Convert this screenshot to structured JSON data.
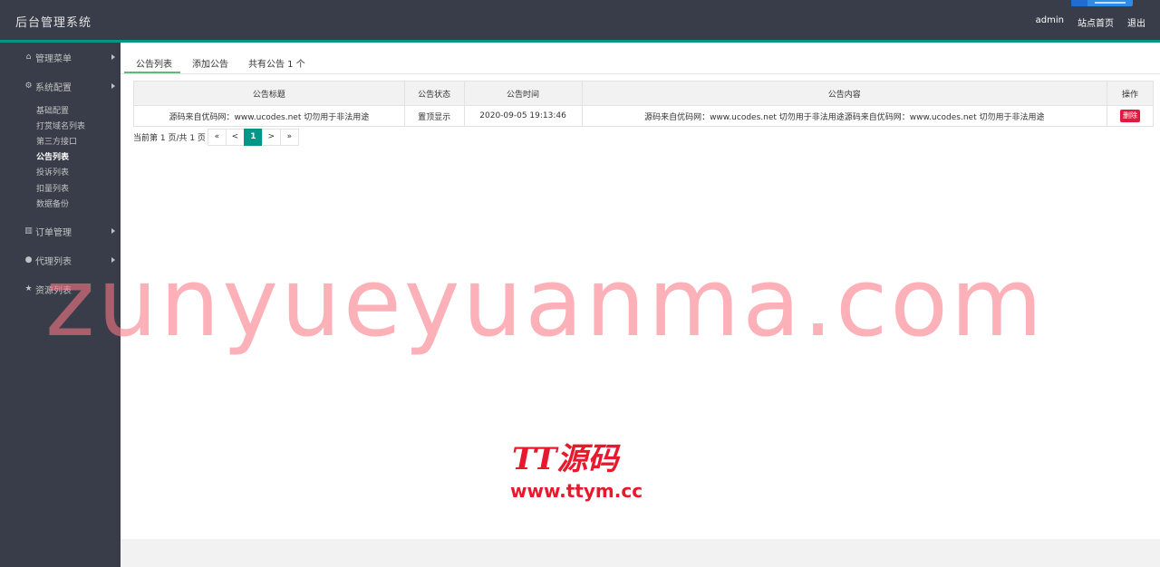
{
  "header": {
    "title": "后台管理系统",
    "links": [
      "admin",
      "站点首页",
      "退出"
    ]
  },
  "sidebar": {
    "items": [
      {
        "label": "管理菜单",
        "icon": "home-icon"
      },
      {
        "label": "系统配置",
        "icon": "gears-icon"
      },
      {
        "label": "订单管理",
        "icon": "bar-chart-icon"
      },
      {
        "label": "代理列表",
        "icon": "user-icon"
      },
      {
        "label": "资源列表",
        "icon": "star-icon"
      }
    ],
    "sub_items": [
      "基础配置",
      "打赏域名列表",
      "第三方接口",
      "公告列表",
      "投诉列表",
      "扣量列表",
      "数据备份"
    ]
  },
  "tabs": {
    "list": "公告列表",
    "add": "添加公告",
    "count": "共有公告 1 个"
  },
  "table": {
    "headers": [
      "公告标题",
      "公告状态",
      "公告时间",
      "公告内容",
      "操作"
    ],
    "rows": [
      {
        "title": "源码来自优码网：www.ucodes.net 切勿用于非法用途",
        "status": "置顶显示",
        "time": "2020-09-05 19:13:46",
        "content": "源码来自优码网：www.ucodes.net 切勿用于非法用途源码来自优码网：www.ucodes.net 切勿用于非法用途",
        "action": "删除"
      }
    ]
  },
  "pagination": {
    "info": "当前第 1 页/共 1 页",
    "first": "«",
    "prev": "<",
    "current": "1",
    "next": ">",
    "last": "»"
  },
  "watermarks": {
    "big": "zunyueyuanma.com",
    "logo": "TT源码",
    "url": "www.ttym.cc"
  },
  "colors": {
    "header_bg": "#393d49",
    "accent": "#009688",
    "tab_active": "#5fb878",
    "danger": "#e0193d"
  }
}
